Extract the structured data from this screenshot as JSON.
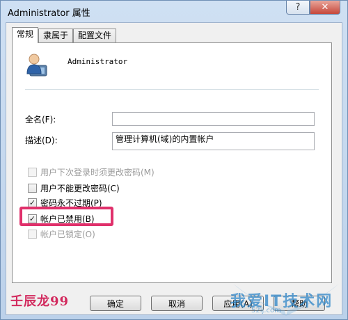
{
  "window": {
    "title": "Administrator 属性",
    "help_label": "?",
    "close_label": "✕"
  },
  "tabs": [
    {
      "label": "常规"
    },
    {
      "label": "隶属于"
    },
    {
      "label": "配置文件"
    }
  ],
  "general": {
    "username": "Administrator",
    "fullname_label": "全名(F):",
    "fullname_value": "",
    "description_label": "描述(D):",
    "description_value": "管理计算机(域)的内置帐户"
  },
  "checkboxes": [
    {
      "label": "用户下次登录时须更改密码(M)",
      "checked": false,
      "disabled": true
    },
    {
      "label": "用户不能更改密码(C)",
      "checked": false,
      "disabled": false
    },
    {
      "label": "密码永不过期(P)",
      "checked": true,
      "disabled": false
    },
    {
      "label": "帐户已禁用(B)",
      "checked": true,
      "disabled": false
    },
    {
      "label": "帐户已锁定(O)",
      "checked": false,
      "disabled": true
    }
  ],
  "buttons": {
    "ok": "确定",
    "cancel": "取消",
    "apply": "应用(A)",
    "help": "帮助"
  },
  "watermarks": {
    "left": "壬辰龙99",
    "right": "我爱IT技术网",
    "right_sub": "52ij.com"
  },
  "colors": {
    "highlight": "#e0306b",
    "window_border": "#6f8fb5"
  }
}
